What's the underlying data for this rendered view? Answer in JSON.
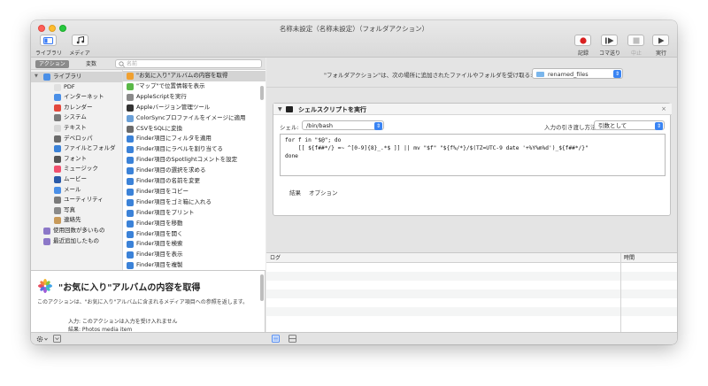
{
  "window": {
    "title": "名称未設定（名称未設定）（フォルダアクション）"
  },
  "toolbar": {
    "left": [
      {
        "label": "ライブラリ",
        "icon": "library-icon"
      },
      {
        "label": "メディア",
        "icon": "music-icon"
      }
    ],
    "right": [
      {
        "label": "記録",
        "icon": "record-icon",
        "enabled": true
      },
      {
        "label": "コマ送り",
        "icon": "step-icon",
        "enabled": true
      },
      {
        "label": "中止",
        "icon": "stop-icon",
        "enabled": false
      },
      {
        "label": "実行",
        "icon": "run-icon",
        "enabled": true
      }
    ]
  },
  "library": {
    "tabs": {
      "actions": "アクション",
      "variables": "変数"
    },
    "search_placeholder": "名前",
    "categories": [
      {
        "label": "ライブラリ",
        "icon": "folder-icon",
        "color": "#4a8fe7",
        "expanded": true,
        "level": 0
      },
      {
        "label": "PDF",
        "icon": "pdf-icon",
        "color": "#e0e0e0",
        "level": 1
      },
      {
        "label": "インターネット",
        "icon": "globe-icon",
        "color": "#4a8fe7",
        "level": 1
      },
      {
        "label": "カレンダー",
        "icon": "calendar-icon",
        "color": "#e2483d",
        "level": 1
      },
      {
        "label": "システム",
        "icon": "gear-icon",
        "color": "#7a7a7a",
        "level": 1
      },
      {
        "label": "テキスト",
        "icon": "text-icon",
        "color": "#d8d8d8",
        "level": 1
      },
      {
        "label": "デベロッパ",
        "icon": "tools-icon",
        "color": "#6b6b6b",
        "level": 1
      },
      {
        "label": "ファイルとフォルダ",
        "icon": "finder-icon",
        "color": "#3b82d8",
        "level": 1
      },
      {
        "label": "フォント",
        "icon": "font-icon",
        "color": "#555555",
        "level": 1
      },
      {
        "label": "ミュージック",
        "icon": "music-note-icon",
        "color": "#f0506e",
        "level": 1
      },
      {
        "label": "ムービー",
        "icon": "quicktime-icon",
        "color": "#2a5aa8",
        "level": 1
      },
      {
        "label": "メール",
        "icon": "mail-icon",
        "color": "#4a8fe7",
        "level": 1
      },
      {
        "label": "ユーティリティ",
        "icon": "utility-icon",
        "color": "#7a7a7a",
        "level": 1
      },
      {
        "label": "写真",
        "icon": "photo-icon",
        "color": "#8a8a8a",
        "level": 1
      },
      {
        "label": "連絡先",
        "icon": "contacts-icon",
        "color": "#c89a5a",
        "level": 1
      },
      {
        "label": "使用回数が多いもの",
        "icon": "smart-folder-icon",
        "color": "#8c78c8",
        "level": 0
      },
      {
        "label": "最近追加したもの",
        "icon": "smart-folder-icon",
        "color": "#8c78c8",
        "level": 0
      }
    ],
    "actions": [
      {
        "label": "\"お気に入り\"アルバムの内容を取得",
        "icon": "photos-icon",
        "color": "#f0a030"
      },
      {
        "label": "\"マップ\"で位置情報を表示",
        "icon": "maps-icon",
        "color": "#5ab848"
      },
      {
        "label": "AppleScriptを実行",
        "icon": "script-icon",
        "color": "#8a8a8a"
      },
      {
        "label": "Appleバージョン管理ツール",
        "icon": "terminal-icon",
        "color": "#333333"
      },
      {
        "label": "ColorSyncプロファイルをイメージに適用",
        "icon": "colorsync-icon",
        "color": "#6aa0d8"
      },
      {
        "label": "CSVをSQLに変換",
        "icon": "tools-icon",
        "color": "#6b6b6b"
      },
      {
        "label": "Finder項目にフィルタを適用",
        "icon": "finder-icon",
        "color": "#3b82d8"
      },
      {
        "label": "Finder項目にラベルを割り当てる",
        "icon": "finder-icon",
        "color": "#3b82d8"
      },
      {
        "label": "Finder項目のSpotlightコメントを設定",
        "icon": "finder-icon",
        "color": "#3b82d8"
      },
      {
        "label": "Finder項目の選択を求める",
        "icon": "finder-icon",
        "color": "#3b82d8"
      },
      {
        "label": "Finder項目の名前を変更",
        "icon": "finder-icon",
        "color": "#3b82d8"
      },
      {
        "label": "Finder項目をコピー",
        "icon": "finder-icon",
        "color": "#3b82d8"
      },
      {
        "label": "Finder項目をゴミ箱に入れる",
        "icon": "finder-icon",
        "color": "#3b82d8"
      },
      {
        "label": "Finder項目をプリント",
        "icon": "finder-icon",
        "color": "#3b82d8"
      },
      {
        "label": "Finder項目を移動",
        "icon": "finder-icon",
        "color": "#3b82d8"
      },
      {
        "label": "Finder項目を開く",
        "icon": "finder-icon",
        "color": "#3b82d8"
      },
      {
        "label": "Finder項目を検索",
        "icon": "finder-icon",
        "color": "#3b82d8"
      },
      {
        "label": "Finder項目を表示",
        "icon": "finder-icon",
        "color": "#3b82d8"
      },
      {
        "label": "Finder項目を複製",
        "icon": "finder-icon",
        "color": "#3b82d8"
      }
    ]
  },
  "description": {
    "title": "\"お気に入り\"アルバムの内容を取得",
    "body": "このアクションは、\"お気に入り\"アルバムに含まれるメディア項目への参照を返します。",
    "input": "入力: このアクションは入力を受け入れません",
    "result": "結果: Photos media item"
  },
  "workflow": {
    "receives_text": "\"フォルダアクション\"は、次の場所に追加されたファイルやフォルダを受け取る:",
    "folder": "renamed_files",
    "action": {
      "title": "シェルスクリプトを実行",
      "shell_label": "シェル:",
      "shell_value": "/bin/bash",
      "pass_input_label": "入力の引き渡し方法:",
      "pass_input_value": "引数として",
      "code_lines": [
        "for f in \"$@\"; do",
        "    [[ ${f##*/} =~ ^[0-9]{8}_.*$ ]] || mv \"$f\" \"${f%/*}/$(TZ=UTC-9 date '+%Y%m%d')_${f##*/}\"",
        "done"
      ],
      "tabs": [
        "結果",
        "オプション"
      ]
    }
  },
  "log": {
    "col_log": "ログ",
    "col_time": "時間"
  }
}
